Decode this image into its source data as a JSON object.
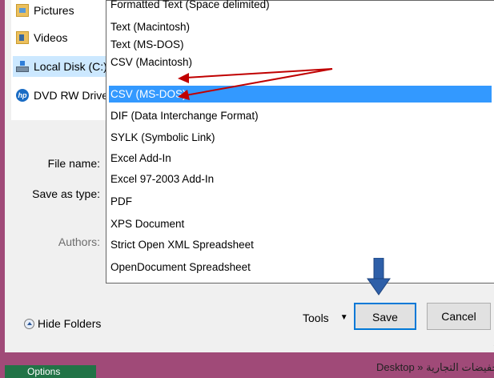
{
  "nav": {
    "items": [
      {
        "label": "Pictures",
        "icon": "pictures-folder-icon"
      },
      {
        "label": "Videos",
        "icon": "videos-folder-icon"
      },
      {
        "label": "Local Disk (C:)",
        "icon": "local-disk-icon"
      },
      {
        "label": "DVD RW Drive",
        "icon": "dvd-drive-icon"
      }
    ]
  },
  "form": {
    "file_name_label": "File name:",
    "save_as_type_label": "Save as type:",
    "authors_label": "Authors:"
  },
  "dropdown": {
    "options": [
      "Formatted Text (Space delimited)",
      "Text (Macintosh)",
      "Text (MS-DOS)",
      "CSV (Macintosh)",
      "CSV (MS-DOS)",
      "DIF (Data Interchange Format)",
      "SYLK (Symbolic Link)",
      "Excel Add-In",
      "Excel 97-2003 Add-In",
      "PDF",
      "XPS Document",
      "Strict Open XML Spreadsheet",
      "OpenDocument Spreadsheet"
    ],
    "selected": "CSV (MS-DOS)"
  },
  "footer": {
    "hide_folders_label": "Hide Folders",
    "tools_label": "Tools",
    "tools_caret": "▼",
    "save_label": "Save",
    "cancel_label": "Cancel"
  },
  "background": {
    "green_tab_label": "Options",
    "breadcrumb": "Desktop » والتخفيضات التجارية"
  },
  "colors": {
    "selection": "#3399ff",
    "annotation_arrow_red": "#c00000",
    "annotation_arrow_blue": "#2e5fa8",
    "frame": "#a04a78"
  }
}
